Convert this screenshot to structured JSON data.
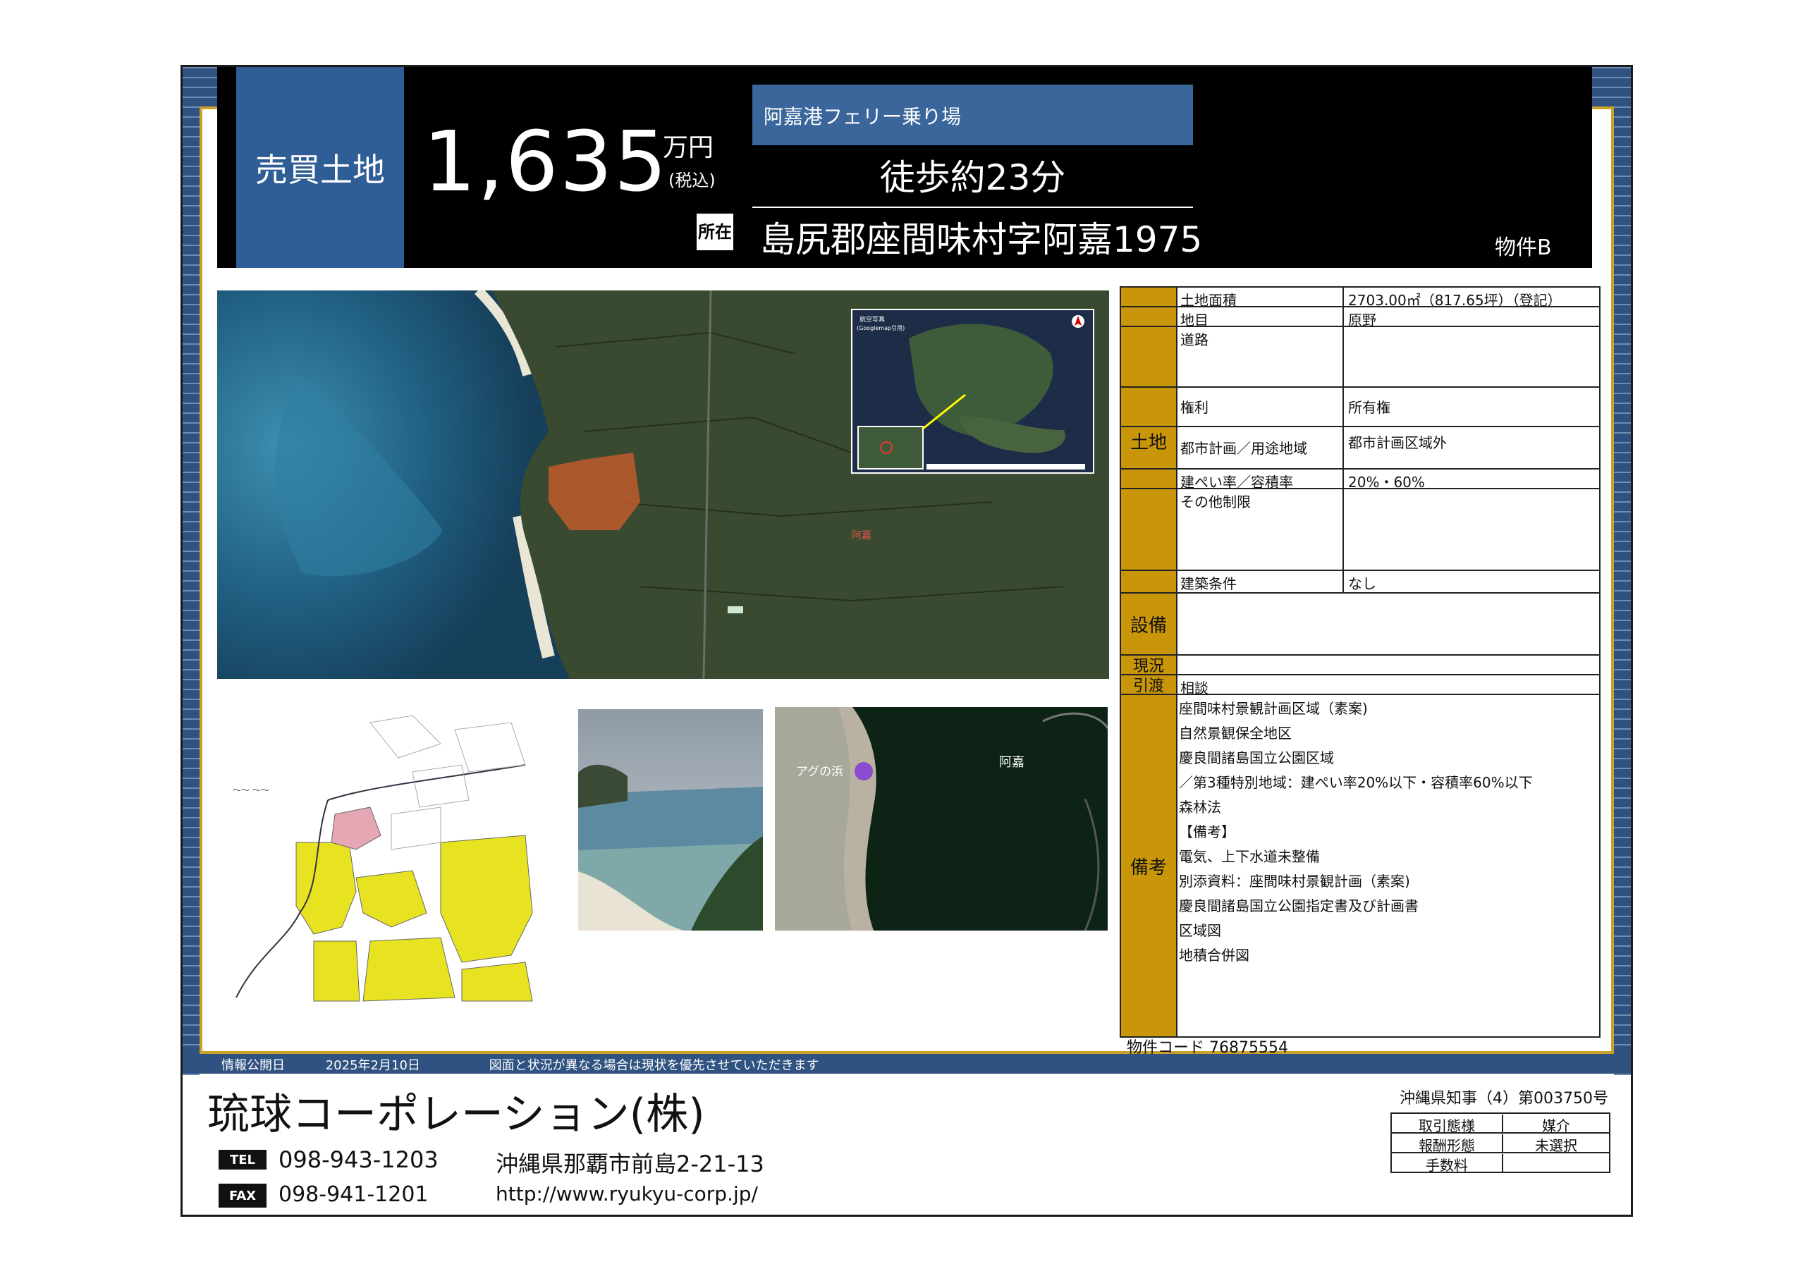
{
  "header": {
    "type": "売買土地",
    "price": "1,635",
    "price_unit": "万円",
    "tax": "(税込)",
    "station": "阿嘉港フェリー乗り場",
    "walk": "徒歩約23分",
    "address_icon": "所在",
    "address": "島尻郡座間味村字阿嘉1975",
    "bukken": "物件B"
  },
  "maps": {
    "aerial_label": "阿嘉",
    "inset_title": "航空写真",
    "inset_subtitle": "(Googlemap引用)",
    "beach_label": "アグの浜",
    "beach_map_label": "阿嘉"
  },
  "table": {
    "categories": {
      "land": "土地",
      "equipment": "設備",
      "current": "現況",
      "handover": "引渡",
      "remarks": "備考"
    },
    "rows": [
      {
        "label": "土地面積",
        "value": "2703.00㎡（817.65坪）（登記）"
      },
      {
        "label": "地目",
        "value": "原野"
      },
      {
        "label": "道路",
        "value": ""
      },
      {
        "label": "権利",
        "value": "所有権"
      },
      {
        "label": "都市計画／用途地域",
        "value": "都市計画区域外"
      },
      {
        "label": "建ぺい率／容積率",
        "value": "20%・60%"
      },
      {
        "label": "その他制限",
        "value": ""
      },
      {
        "label": "建築条件",
        "value": "なし"
      }
    ],
    "handover_value": "相談",
    "notes": [
      "座間味村景観計画区域（素案)",
      "自然景観保全地区",
      "慶良間諸島国立公園区域",
      "／第3種特別地域：建ぺい率20%以下・容積率60%以下",
      "森林法",
      "【備考】",
      "電気、上下水道未整備",
      "別添資料：座間味村景観計画（素案)",
      "慶良間諸島国立公園指定書及び計画書",
      "区域図",
      "地積合併図"
    ]
  },
  "code": "物件コード 76875554",
  "strip": {
    "published_label": "情報公開日",
    "published_date": "2025年2月10日",
    "note": "図面と状況が異なる場合は現状を優先させていただきます"
  },
  "footer": {
    "company": "琉球コーポレーション(株)",
    "license": "沖縄県知事（4）第003750号",
    "tel_icon": "TEL",
    "tel": "098-943-1203",
    "fax_icon": "FAX",
    "fax": "098-941-1201",
    "address": "沖縄県那覇市前島2-21-13",
    "url": "http://www.ryukyu-corp.jp/",
    "mini_table": [
      {
        "label": "取引態様",
        "value": "媒介"
      },
      {
        "label": "報酬形態",
        "value": "未選択"
      },
      {
        "label": "手数料",
        "value": ""
      }
    ]
  }
}
